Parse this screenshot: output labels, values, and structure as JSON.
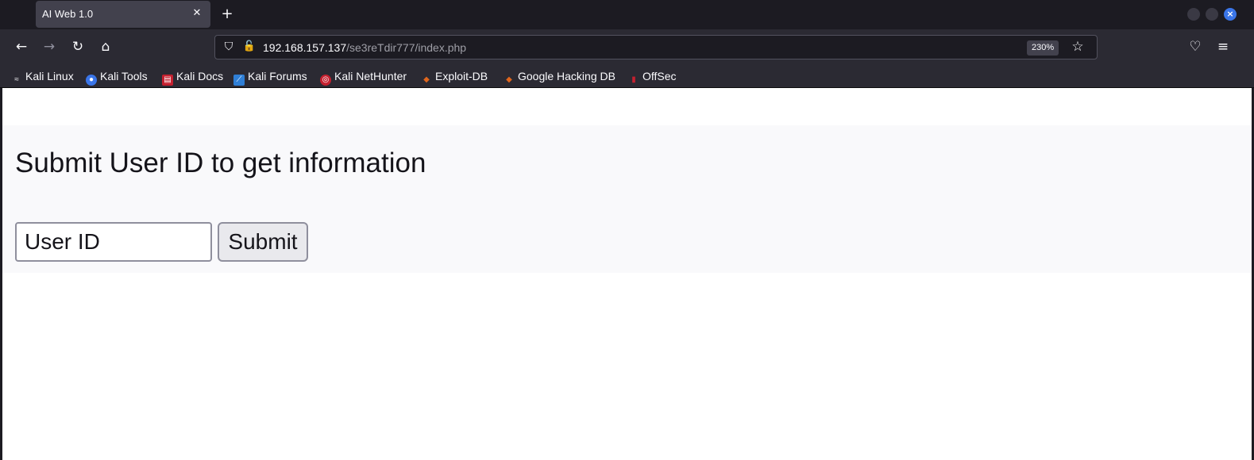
{
  "tab": {
    "title": "AI Web 1.0",
    "close_glyph": "✕"
  },
  "newtab_glyph": "+",
  "nav": {
    "back_glyph": "←",
    "forward_glyph": "→",
    "reload_glyph": "↻",
    "home_glyph": "⌂",
    "url_host": "192.168.157.137",
    "url_path": "/se3reTdir777/index.php",
    "zoom": "230%",
    "star_glyph": "☆",
    "pocket_glyph": "♡",
    "menu_glyph": "≡",
    "shield_glyph": "⛉",
    "lock_glyph": "🔓"
  },
  "bookmarks": [
    {
      "label": "Kali Linux",
      "icon": "kali-dragon-icon",
      "color": "#2b2a33",
      "glyph": "≈"
    },
    {
      "label": "Kali Tools",
      "icon": "kali-tools-icon",
      "color": "#3a75e8",
      "glyph": "●"
    },
    {
      "label": "Kali Docs",
      "icon": "kali-docs-icon",
      "color": "#c4202f",
      "glyph": "▤"
    },
    {
      "label": "Kali Forums",
      "icon": "kali-forums-icon",
      "color": "#2f7fd6",
      "glyph": "⟋"
    },
    {
      "label": "Kali NetHunter",
      "icon": "kali-nethunter-icon",
      "color": "#c4202f",
      "glyph": "◎"
    },
    {
      "label": "Exploit-DB",
      "icon": "exploit-db-icon",
      "color": "#e0661d",
      "glyph": "◆"
    },
    {
      "label": "Google Hacking DB",
      "icon": "ghdb-icon",
      "color": "#e0661d",
      "glyph": "◆"
    },
    {
      "label": "OffSec",
      "icon": "offsec-icon",
      "color": "#c4202f",
      "glyph": "▮"
    }
  ],
  "page": {
    "heading": "Submit User ID to get information",
    "input_placeholder": "User ID",
    "submit_label": "Submit"
  }
}
